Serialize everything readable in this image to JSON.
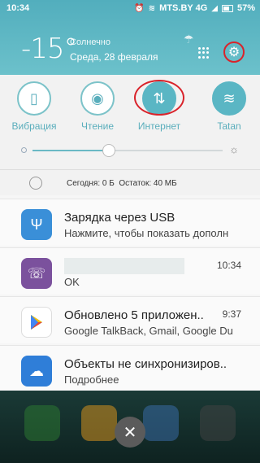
{
  "status_bar": {
    "time": "10:34",
    "carrier": "MTS.BY 4G",
    "battery": "57%"
  },
  "weather": {
    "temperature": "-15°",
    "condition": "Солнечно",
    "date": "Среда, 28 февраля"
  },
  "quick_toggles": [
    {
      "label": "Вибрация",
      "icon": "vibration-icon",
      "active": false
    },
    {
      "label": "Чтение",
      "icon": "eye-icon",
      "active": false
    },
    {
      "label": "Интернет",
      "icon": "mobile-data-icon",
      "active": true
    },
    {
      "label": "Tatan",
      "icon": "wifi-icon",
      "active": false
    }
  ],
  "brightness": {
    "level": 0.4
  },
  "data_usage": {
    "today": "Сегодня: 0 Б",
    "remaining": "Остаток: 40 МБ"
  },
  "notifications": [
    {
      "icon": "usb-icon",
      "icon_color": "#3a8fd8",
      "title": "Зарядка через USB",
      "text": "Нажмите, чтобы показать дополн",
      "time": ""
    },
    {
      "icon": "viber-icon",
      "icon_color": "#7b519d",
      "title": "",
      "text": "OK",
      "time": "10:34"
    },
    {
      "icon": "play-store-icon",
      "icon_color": "#ffffff",
      "title": "Обновлено 5 приложен..",
      "text": "Google TalkBack, Gmail, Google Du",
      "time": "9:37"
    },
    {
      "icon": "cloud-icon",
      "icon_color": "#2f7ed8",
      "title": "Объекты не синхронизиров..",
      "text": "Подробнее",
      "time": ""
    }
  ],
  "colors": {
    "accent": "#5ab6c4",
    "highlight": "#d9232b"
  }
}
